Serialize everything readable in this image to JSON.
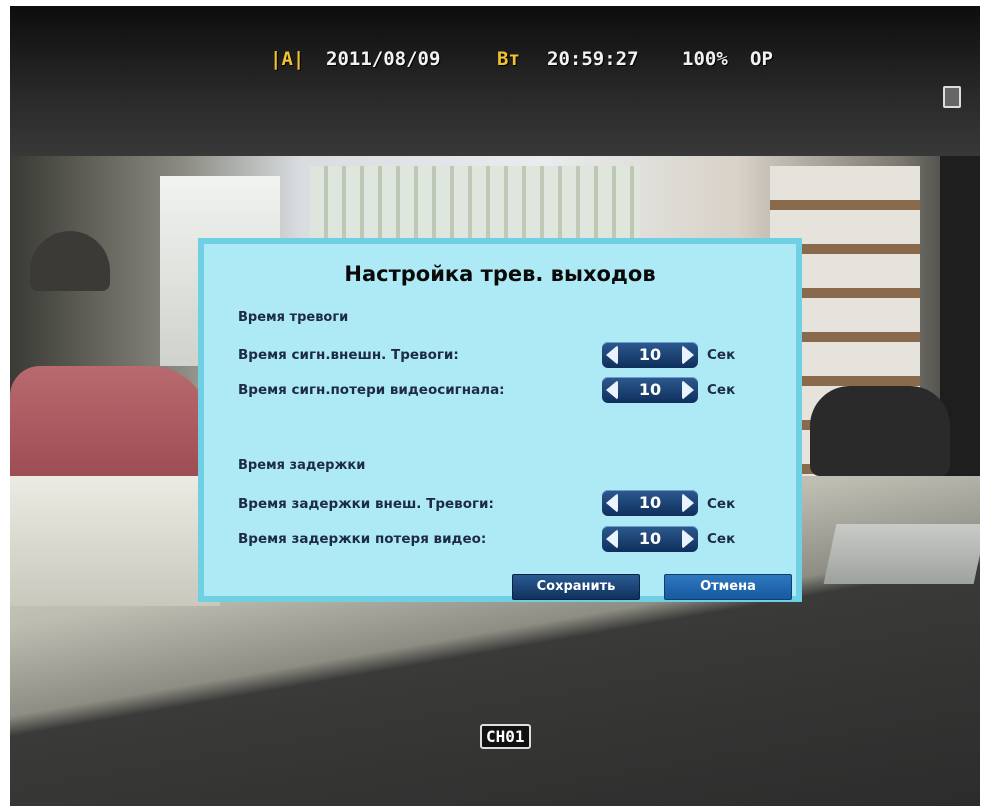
{
  "osd": {
    "mode": "|A|",
    "date": "2011/08/09",
    "day": "Вт",
    "time": "20:59:27",
    "zoom": "100%",
    "status": "OP"
  },
  "channel": "CH01",
  "dialog": {
    "title": "Настройка трев. выходов",
    "section_alarm": "Время тревоги",
    "section_delay": "Время задержки",
    "rows": [
      {
        "label": "Время сигн.внешн. Тревоги:",
        "value": "10",
        "unit": "Сек"
      },
      {
        "label": "Время сигн.потери видеосигнала:",
        "value": "10",
        "unit": "Сек"
      },
      {
        "label": "Время задержки внеш. Тревоги:",
        "value": "10",
        "unit": "Сек"
      },
      {
        "label": "Время задержки потеря видео:",
        "value": "10",
        "unit": "Сек"
      }
    ],
    "save_label": "Сохранить",
    "cancel_label": "Отмена"
  },
  "colors": {
    "dialog_bg": "#aeeaf5",
    "dialog_border": "#6fd0e4",
    "spinner_bg": "#0e2f5c",
    "osd_accent": "#f1c230"
  }
}
